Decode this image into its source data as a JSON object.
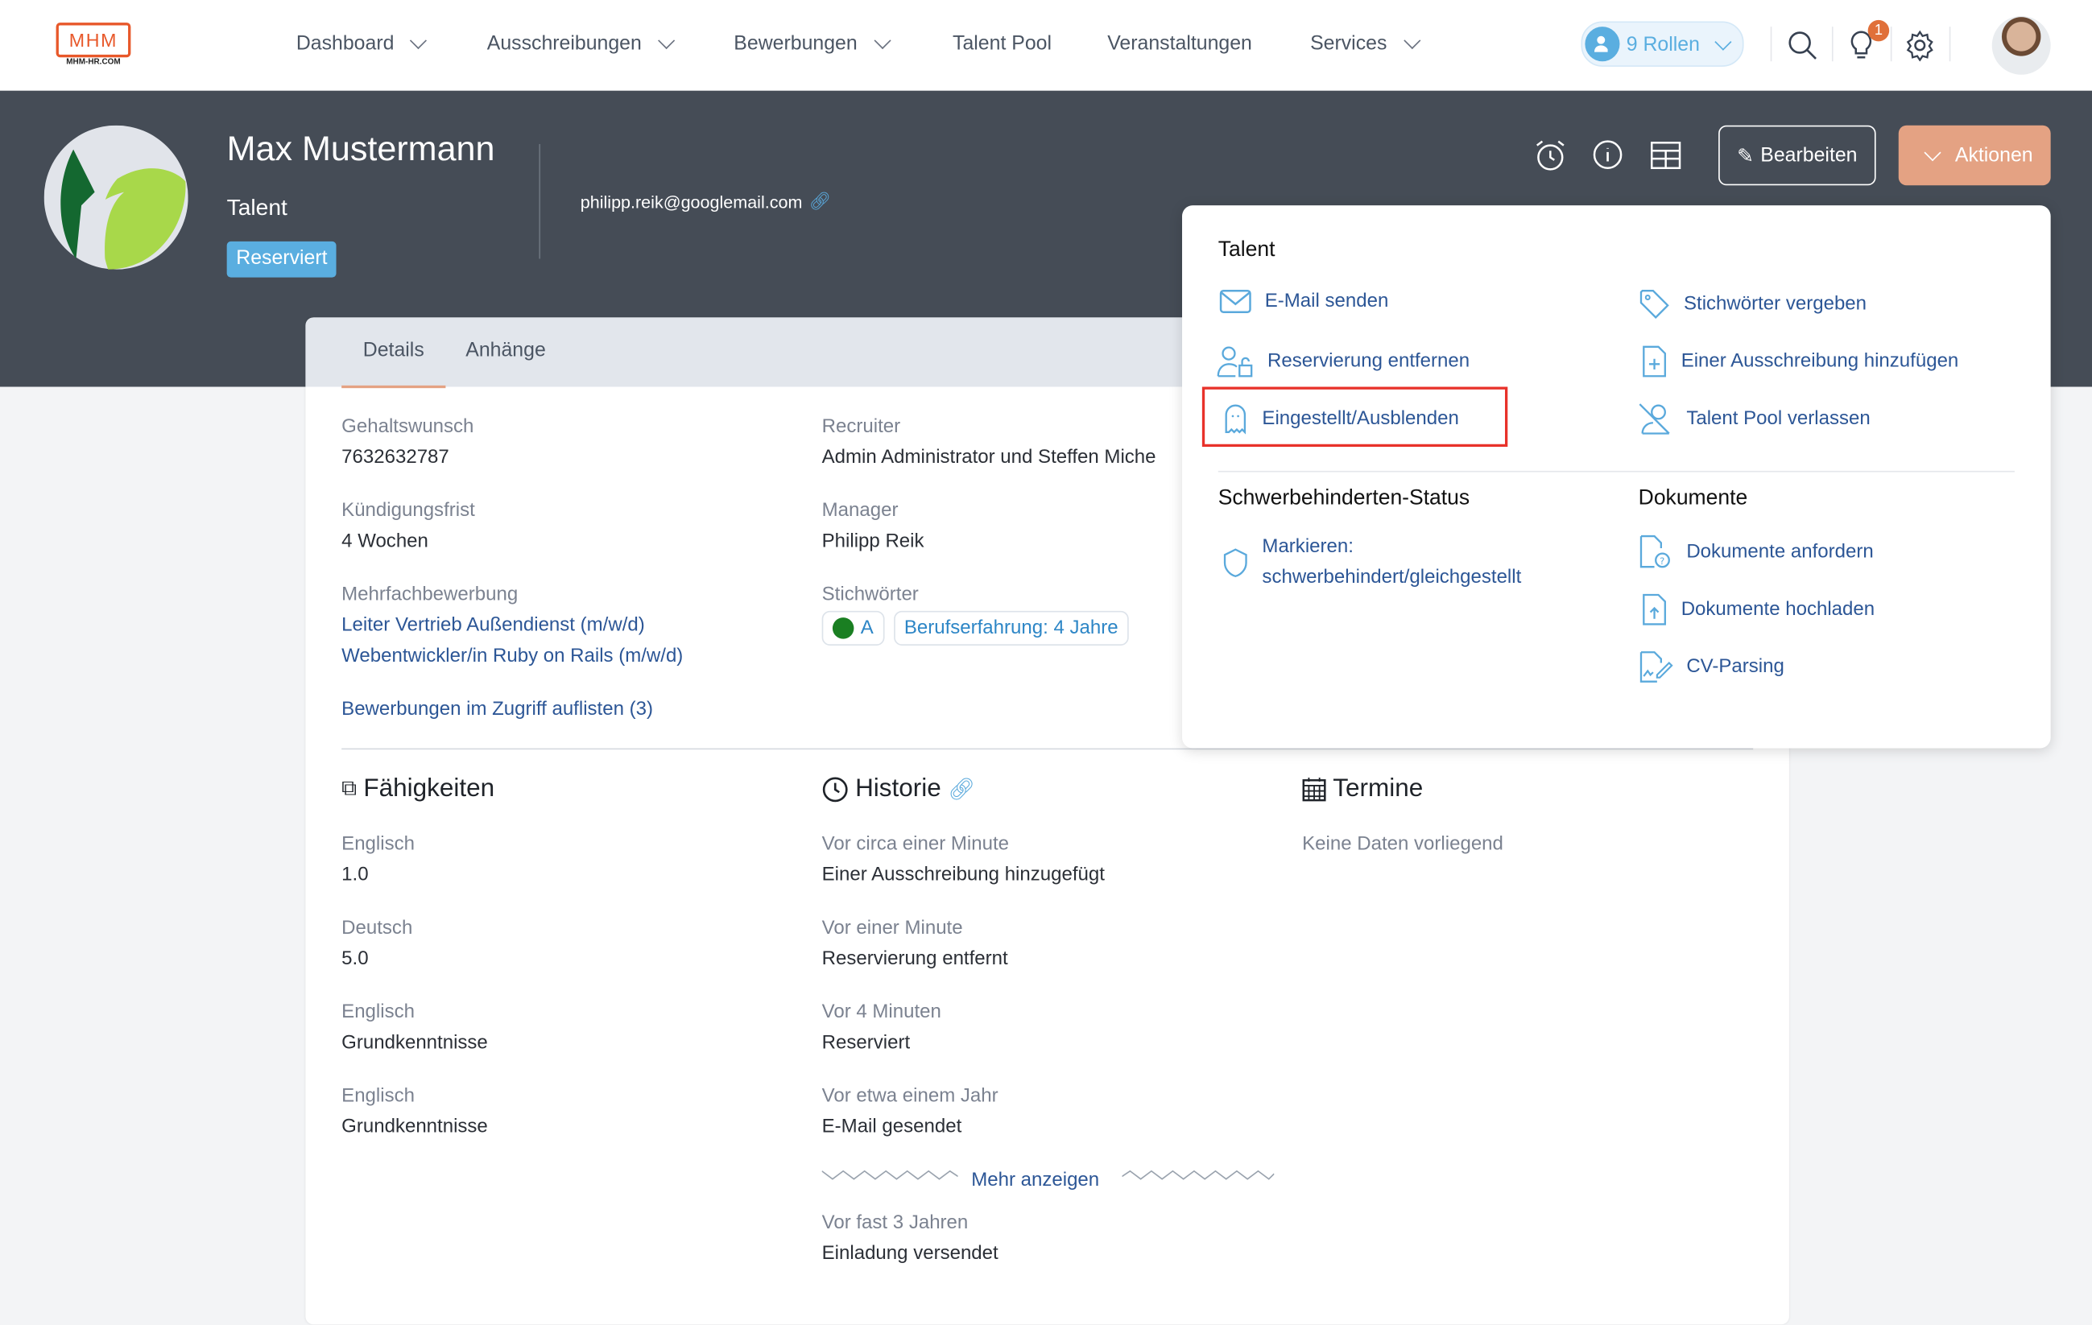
{
  "brand": {
    "logo_text": "MHM",
    "logo_sub": "MHM-HR.COM"
  },
  "nav": [
    {
      "label": "Dashboard",
      "dropdown": true
    },
    {
      "label": "Ausschreibungen",
      "dropdown": true
    },
    {
      "label": "Bewerbungen",
      "dropdown": true
    },
    {
      "label": "Talent Pool",
      "dropdown": false
    },
    {
      "label": "Veranstaltungen",
      "dropdown": false
    },
    {
      "label": "Services",
      "dropdown": true
    }
  ],
  "topbar": {
    "roles_label": "9 Rollen",
    "notification_count": "1"
  },
  "profile": {
    "name": "Max Mustermann",
    "type": "Talent",
    "status_badge": "Reserviert",
    "email": "philipp.reik@googlemail.com"
  },
  "actions": {
    "edit_label": "Bearbeiten",
    "actions_label": "Aktionen"
  },
  "tabs": [
    {
      "label": "Details",
      "active": true
    },
    {
      "label": "Anhänge",
      "active": false
    }
  ],
  "details": {
    "salary": {
      "label": "Gehaltswunsch",
      "value": "7632632787"
    },
    "notice": {
      "label": "Kündigungsfrist",
      "value": "4 Wochen"
    },
    "multi": {
      "label": "Mehrfachbewerbung",
      "links": [
        "Leiter Vertrieb Außendienst (m/w/d)",
        "Webentwickler/in Ruby on Rails (m/w/d)"
      ]
    },
    "list_link": "Bewerbungen im Zugriff auflisten (3)",
    "recruiter": {
      "label": "Recruiter",
      "value": "Admin Administrator und Steffen Miche"
    },
    "manager": {
      "label": "Manager",
      "value": "Philipp Reik"
    },
    "keywords": {
      "label": "Stichwörter",
      "tags": [
        "A",
        "Berufserfahrung: 4 Jahre"
      ]
    }
  },
  "skills": {
    "title": "Fähigkeiten",
    "items": [
      {
        "label": "Englisch",
        "value": "1.0"
      },
      {
        "label": "Deutsch",
        "value": "5.0"
      },
      {
        "label": "Englisch",
        "value": "Grundkenntnisse"
      },
      {
        "label": "Englisch",
        "value": "Grundkenntnisse"
      }
    ]
  },
  "history": {
    "title": "Historie",
    "items": [
      {
        "time": "Vor circa einer Minute",
        "event": "Einer Ausschreibung hinzugefügt"
      },
      {
        "time": "Vor einer Minute",
        "event": "Reservierung entfernt"
      },
      {
        "time": "Vor 4 Minuten",
        "event": "Reserviert"
      },
      {
        "time": "Vor etwa einem Jahr",
        "event": "E-Mail gesendet"
      }
    ],
    "more": "Mehr anzeigen",
    "last": {
      "time": "Vor fast 3 Jahren",
      "event": "Einladung versendet"
    }
  },
  "appointments": {
    "title": "Termine",
    "empty": "Keine Daten vorliegend"
  },
  "menu": {
    "talent_heading": "Talent",
    "talent_left": [
      "E-Mail senden",
      "Reservierung entfernen",
      "Eingestellt/Ausblenden"
    ],
    "talent_right": [
      "Stichwörter vergeben",
      "Einer Ausschreibung hinzufügen",
      "Talent Pool verlassen"
    ],
    "disability_heading": "Schwerbehinderten-Status",
    "disability_item_line1": "Markieren:",
    "disability_item_line2": "schwerbehindert/gleichgestellt",
    "docs_heading": "Dokumente",
    "docs_items": [
      "Dokumente anfordern",
      "Dokumente hochladen",
      "CV-Parsing"
    ],
    "highlighted_item": "Eingestellt/Ausblenden"
  },
  "colors": {
    "header": "#454c56",
    "accent": "#e4a283",
    "link": "#2c5696",
    "icon": "#5aa9dc",
    "badge": "#5aaee0",
    "highlight": "#e8322a"
  }
}
